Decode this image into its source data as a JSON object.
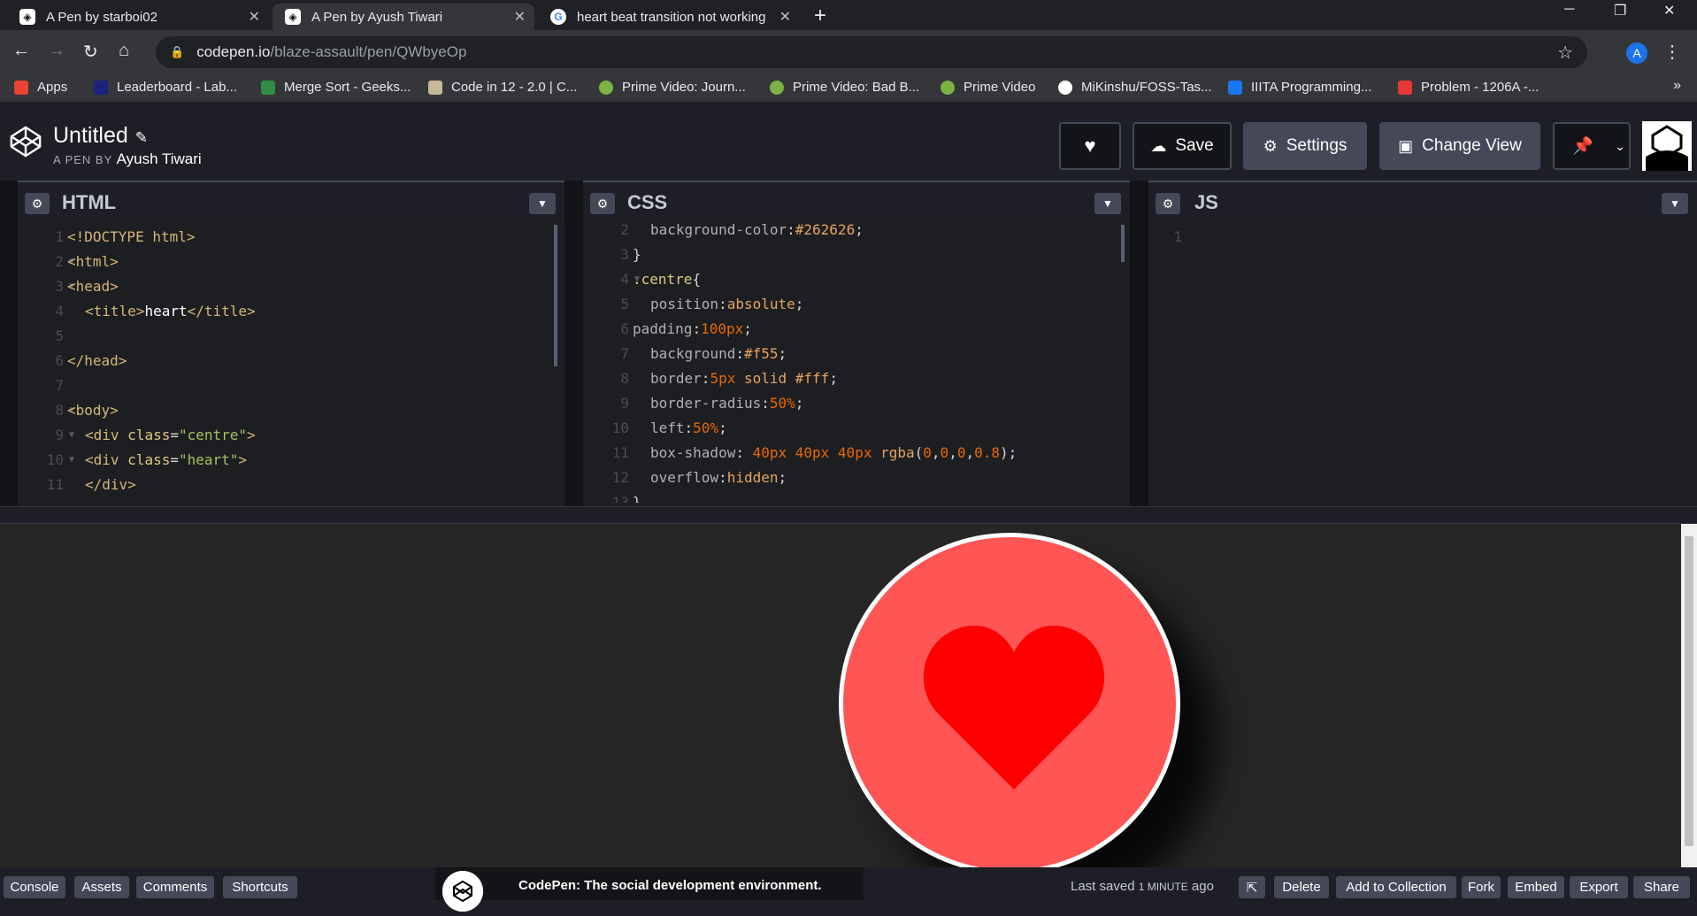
{
  "browser": {
    "tabs": [
      {
        "label": "A Pen by starboi02",
        "icon": "codepen-icon"
      },
      {
        "label": "A Pen by Ayush Tiwari",
        "icon": "codepen-icon",
        "active": true
      },
      {
        "label": "heart beat transition not working",
        "icon": "google-icon"
      }
    ],
    "url_host": "codepen.io",
    "url_path": "/blaze-assault/pen/QWbyeOp",
    "profile_initial": "A",
    "bookmarks": [
      {
        "label": "Apps",
        "color": "#ea4335"
      },
      {
        "label": "Leaderboard - Lab...",
        "color": "#1a237e"
      },
      {
        "label": "Merge Sort - Geeks...",
        "color": "#2f8d46"
      },
      {
        "label": "Code in 12 - 2.0 | C...",
        "color": "#c8b89a"
      },
      {
        "label": "Prime Video: Journ...",
        "color": "#7cb342"
      },
      {
        "label": "Prime Video: Bad B...",
        "color": "#7cb342"
      },
      {
        "label": "Prime Video",
        "color": "#7cb342"
      },
      {
        "label": "MiKinshu/FOSS-Tas...",
        "color": "#24292e"
      },
      {
        "label": "IIITA Programming...",
        "color": "#1877f2"
      },
      {
        "label": "Problem - 1206A -...",
        "color": "#e53935"
      }
    ]
  },
  "header": {
    "title": "Untitled",
    "by_prefix": "A PEN BY",
    "author": "Ayush Tiwari",
    "save_label": "Save",
    "settings_label": "Settings",
    "change_view_label": "Change View"
  },
  "panels": {
    "html": {
      "name": "HTML"
    },
    "css": {
      "name": "CSS"
    },
    "js": {
      "name": "JS"
    }
  },
  "footer": {
    "console": "Console",
    "assets": "Assets",
    "comments": "Comments",
    "shortcuts": "Shortcuts",
    "promo": "CodePen: The social development environment.",
    "saved_prefix": "Last saved",
    "saved_time": "1 MINUTE",
    "saved_suffix": "ago",
    "delete": "Delete",
    "add_to_collection": "Add to Collection",
    "fork": "Fork",
    "embed": "Embed",
    "export": "Export",
    "share": "Share"
  },
  "colors": {
    "accent_red": "#ff5555",
    "heart": "#ff0000",
    "preview_bg": "#262626"
  }
}
